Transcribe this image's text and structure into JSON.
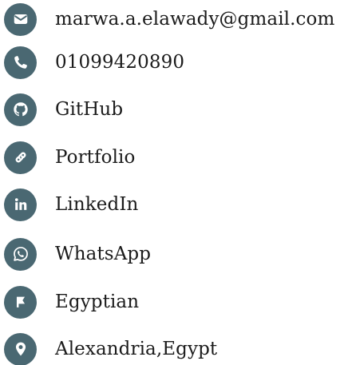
{
  "theme": {
    "icon_background": "#4a6872",
    "icon_foreground": "#ffffff",
    "text_color": "#1b1b1b"
  },
  "contacts": [
    {
      "icon": "envelope-icon",
      "label": "marwa.a.elawady@gmail.com"
    },
    {
      "icon": "phone-icon",
      "label": "01099420890"
    },
    {
      "icon": "github-icon",
      "label": "GitHub"
    },
    {
      "icon": "link-icon",
      "label": "Portfolio"
    },
    {
      "icon": "linkedin-icon",
      "label": "LinkedIn"
    },
    {
      "icon": "whatsapp-icon",
      "label": "WhatsApp"
    },
    {
      "icon": "flag-icon",
      "label": "Egyptian"
    },
    {
      "icon": "map-marker-icon",
      "label": "Alexandria,Egypt"
    }
  ]
}
